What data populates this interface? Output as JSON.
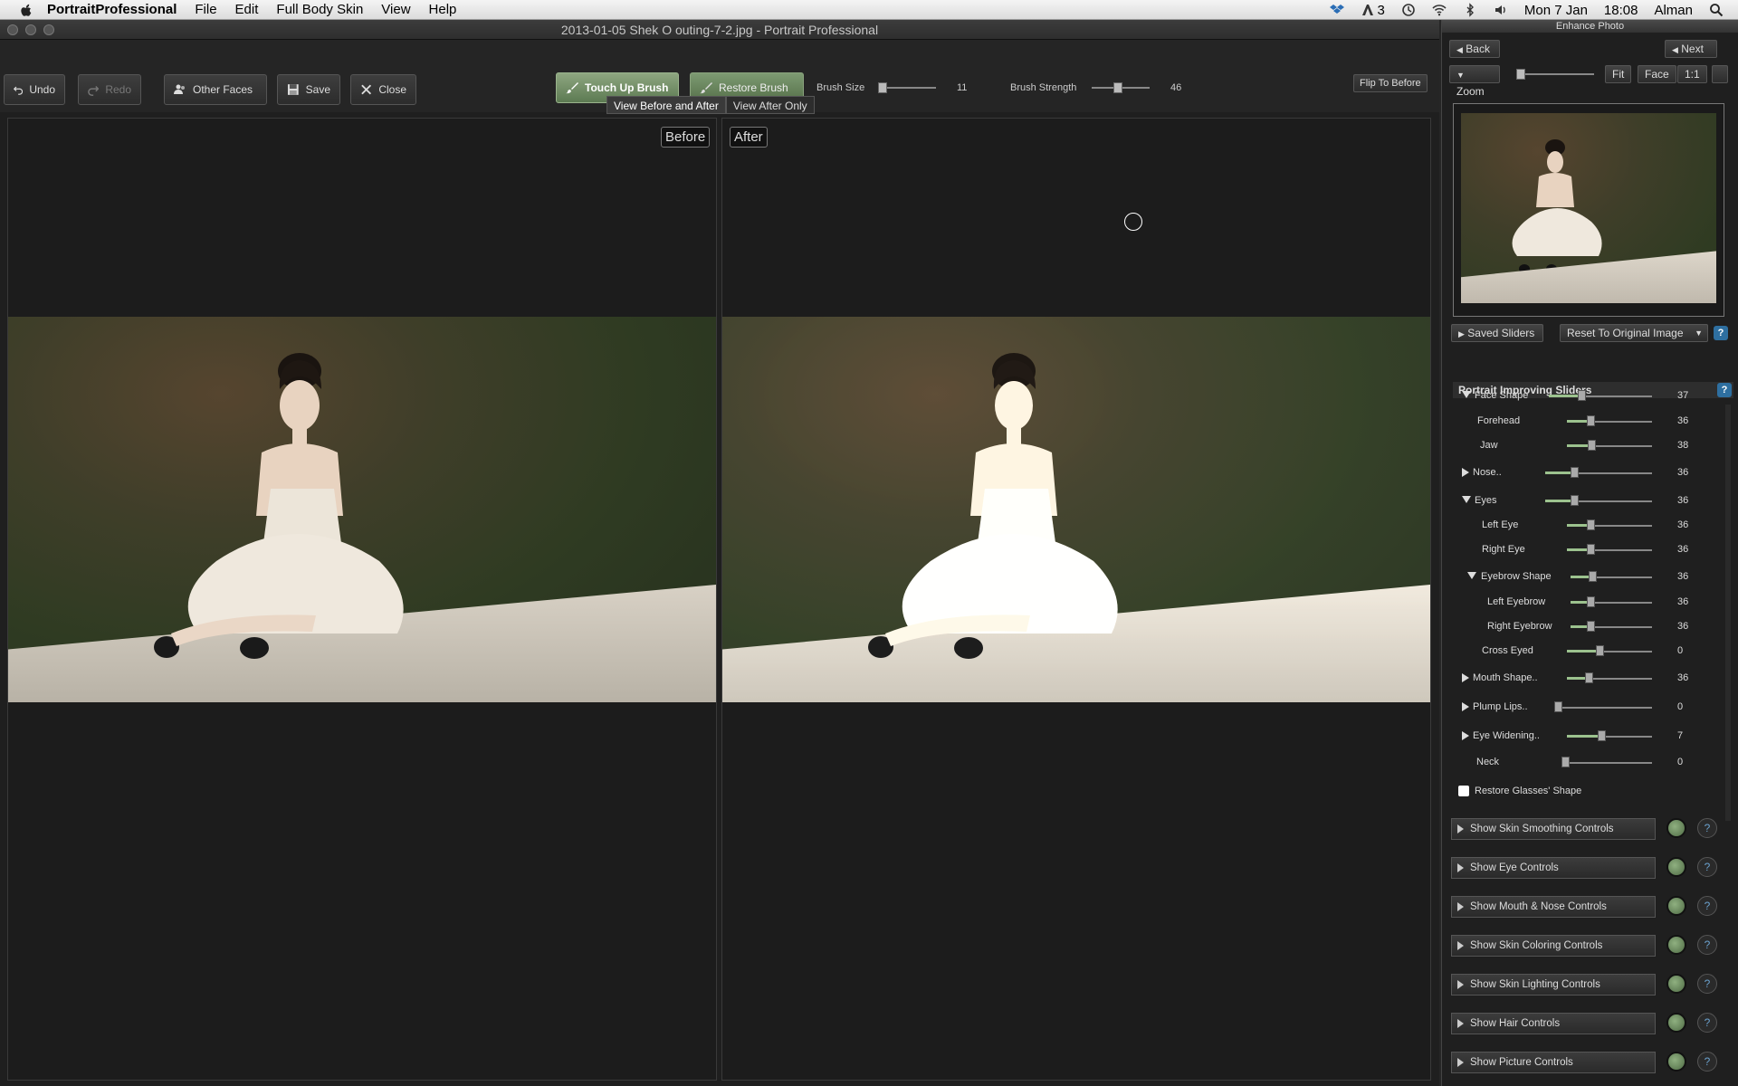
{
  "menubar": {
    "app_name": "PortraitProfessional",
    "menus": [
      "File",
      "Edit",
      "Full Body Skin",
      "View",
      "Help"
    ],
    "badge_count": "3",
    "date": "Mon 7 Jan",
    "time": "18:08",
    "user": "Alman"
  },
  "window": {
    "title": "2013-01-05 Shek O outing-7-2.jpg - Portrait Professional"
  },
  "toolbar": {
    "undo": "Undo",
    "redo": "Redo",
    "other_faces": "Other Faces",
    "save": "Save",
    "close": "Close",
    "touch_up": "Touch Up Brush",
    "restore": "Restore Brush",
    "brush_size_label": "Brush Size",
    "brush_size_value": "11",
    "brush_strength_label": "Brush Strength",
    "brush_strength_value": "46",
    "flip": "Flip To Before"
  },
  "view_tabs": [
    "View Before and After",
    "View After Only"
  ],
  "panes": {
    "before": "Before",
    "after": "After"
  },
  "sidebar": {
    "title": "Enhance Photo",
    "back": "Back",
    "next": "Next",
    "zoom": "Zoom",
    "fit": "Fit",
    "face": "Face",
    "one_to_one": "1:1",
    "saved_sliders": "Saved Sliders",
    "reset": "Reset To Original Image",
    "help": "?",
    "section_title": "Portrait Improving Sliders",
    "sliders": [
      {
        "name": "Face Shape",
        "value": "37"
      },
      {
        "name": "Forehead",
        "value": "36"
      },
      {
        "name": "Jaw",
        "value": "38"
      },
      {
        "name": "Nose..",
        "value": "36"
      },
      {
        "name": "Eyes",
        "value": "36"
      },
      {
        "name": "Left Eye",
        "value": "36"
      },
      {
        "name": "Right Eye",
        "value": "36"
      },
      {
        "name": "Eyebrow Shape",
        "value": "36"
      },
      {
        "name": "Left Eyebrow",
        "value": "36"
      },
      {
        "name": "Right Eyebrow",
        "value": "36"
      },
      {
        "name": "Cross Eyed",
        "value": "0"
      },
      {
        "name": "Mouth Shape..",
        "value": "36"
      },
      {
        "name": "Plump Lips..",
        "value": "0"
      },
      {
        "name": "Eye Widening..",
        "value": "7"
      },
      {
        "name": "Neck",
        "value": "0"
      }
    ],
    "restore_glasses": "Restore Glasses' Shape",
    "controls": [
      "Show Skin Smoothing Controls",
      "Show Eye Controls",
      "Show Mouth & Nose Controls",
      "Show Skin Coloring Controls",
      "Show Skin Lighting Controls",
      "Show Hair Controls",
      "Show Picture Controls"
    ]
  },
  "colors": {
    "accent_green": "#7d9a72",
    "help_blue": "#2e6fa0"
  }
}
